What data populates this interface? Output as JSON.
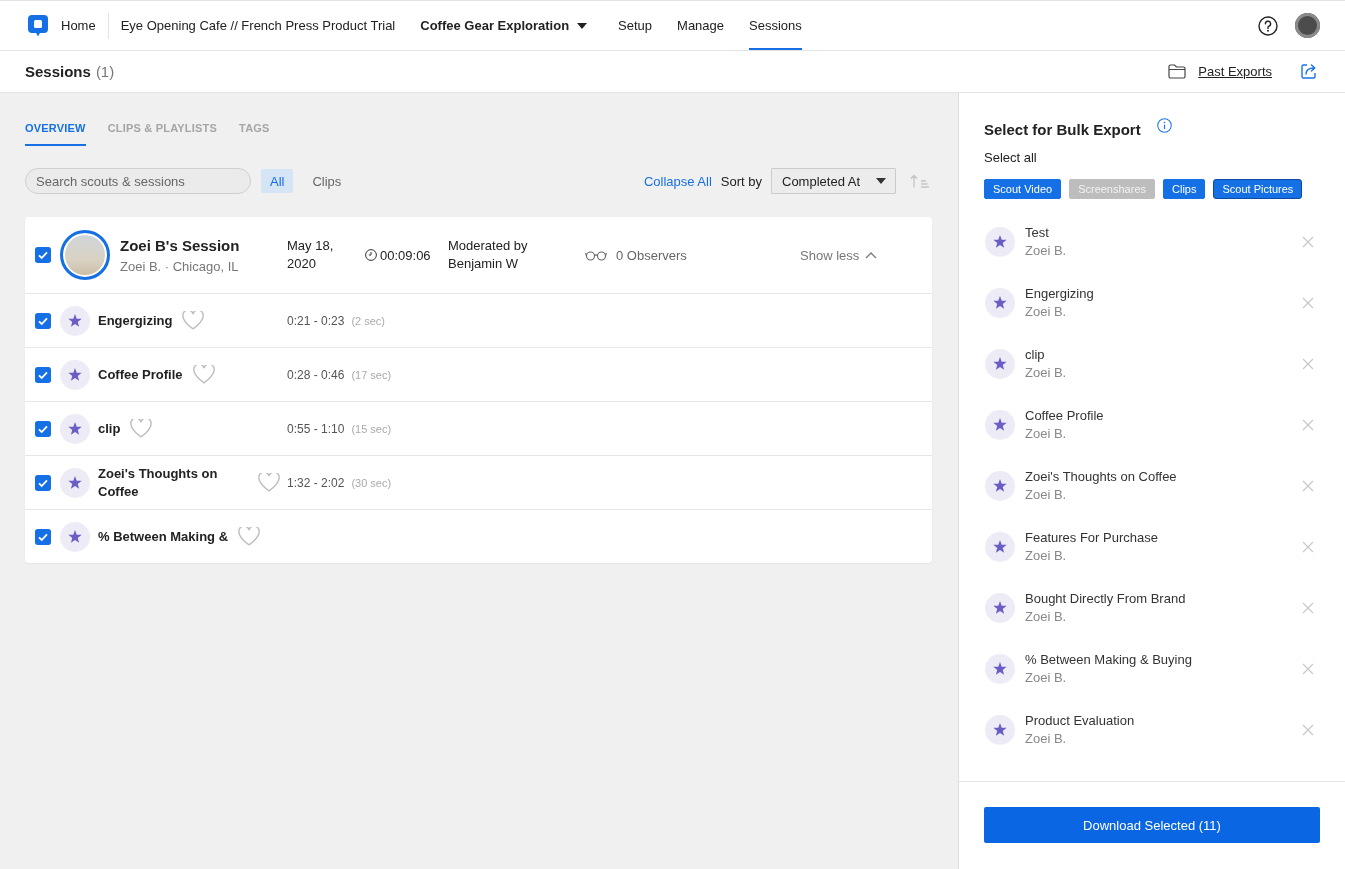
{
  "top_nav": {
    "home": "Home",
    "project": "Eye Opening Cafe // French Press Product Trial",
    "study": "Coffee Gear Exploration",
    "items": [
      {
        "label": "Setup",
        "selected": false
      },
      {
        "label": "Manage",
        "selected": false
      },
      {
        "label": "Sessions",
        "selected": true
      }
    ]
  },
  "page_header": {
    "title": "Sessions",
    "count": "(1)",
    "past_exports": "Past Exports"
  },
  "tabs": [
    {
      "label": "OVERVIEW",
      "selected": true
    },
    {
      "label": "CLIPS & PLAYLISTS",
      "selected": false
    },
    {
      "label": "TAGS",
      "selected": false
    }
  ],
  "toolbar": {
    "search": {
      "placeholder": "Search scouts & sessions"
    },
    "filters": [
      {
        "label": "All",
        "selected": true
      },
      {
        "label": "Clips",
        "selected": false
      }
    ],
    "collapse_all": "Collapse All",
    "sort_label": "Sort by",
    "sort_value": "Completed At"
  },
  "session": {
    "checked": true,
    "title": "Zoei B's Session",
    "subtitle": "Zoei B. · Chicago, IL",
    "date": "May 18, 2020",
    "duration": "00:09:06",
    "moderator": "Moderated by Benjamin W",
    "observers": "0 Observers",
    "toggle": "Show less",
    "clips": [
      {
        "checked": true,
        "title": "Engergizing",
        "favorited": false,
        "range": "0:21 - 0:23",
        "length": "(2 sec)"
      },
      {
        "checked": true,
        "title": "Coffee Profile",
        "favorited": false,
        "range": "0:28 - 0:46",
        "length": "(17 sec)"
      },
      {
        "checked": true,
        "title": "clip",
        "favorited": false,
        "range": "0:55 - 1:10",
        "length": "(15 sec)"
      },
      {
        "checked": true,
        "title": "Zoei's Thoughts on Coffee",
        "favorited": false,
        "range": "1:32 - 2:02",
        "length": "(30 sec)"
      },
      {
        "checked": true,
        "title": "% Between Making &",
        "favorited": false
      }
    ]
  },
  "bulk_export": {
    "title": "Select for Bulk Export",
    "select_all": "Select all",
    "chips": [
      {
        "label": "Scout Video",
        "selected": true,
        "focused": false
      },
      {
        "label": "Screenshares",
        "selected": false,
        "focused": false
      },
      {
        "label": "Clips",
        "selected": true,
        "focused": false
      },
      {
        "label": "Scout Pictures",
        "selected": true,
        "focused": true
      }
    ],
    "items": [
      {
        "title": "Test",
        "author": "Zoei B."
      },
      {
        "title": "Engergizing",
        "author": "Zoei B."
      },
      {
        "title": "clip",
        "author": "Zoei B."
      },
      {
        "title": "Coffee Profile",
        "author": "Zoei B."
      },
      {
        "title": "Zoei's Thoughts on Coffee",
        "author": "Zoei B."
      },
      {
        "title": "Features For Purchase",
        "author": "Zoei B."
      },
      {
        "title": "Bought Directly From Brand",
        "author": "Zoei B."
      },
      {
        "title": "% Between Making & Buying",
        "author": "Zoei B."
      },
      {
        "title": "Product Evaluation",
        "author": "Zoei B."
      }
    ],
    "download": "Download Selected (11)"
  }
}
